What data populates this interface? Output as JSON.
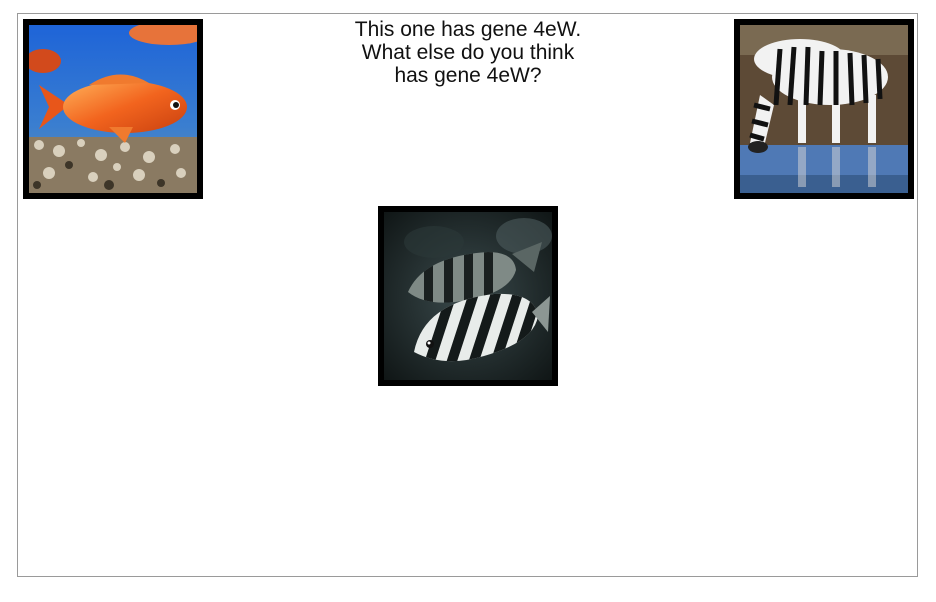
{
  "prompt": {
    "line1": "This one has gene 4eW.",
    "line2": "What else do you think",
    "line3": "has gene 4eW?"
  },
  "cards": [
    {
      "animal": "goldfish",
      "icon": "goldfish-photo"
    },
    {
      "animal": "zebra",
      "icon": "zebra-photo"
    },
    {
      "animal": "sheepshead fish",
      "icon": "striped-fish-photo"
    }
  ],
  "colors": {
    "border": "#000000",
    "frame": "#9a9a9a",
    "text": "#111111"
  }
}
